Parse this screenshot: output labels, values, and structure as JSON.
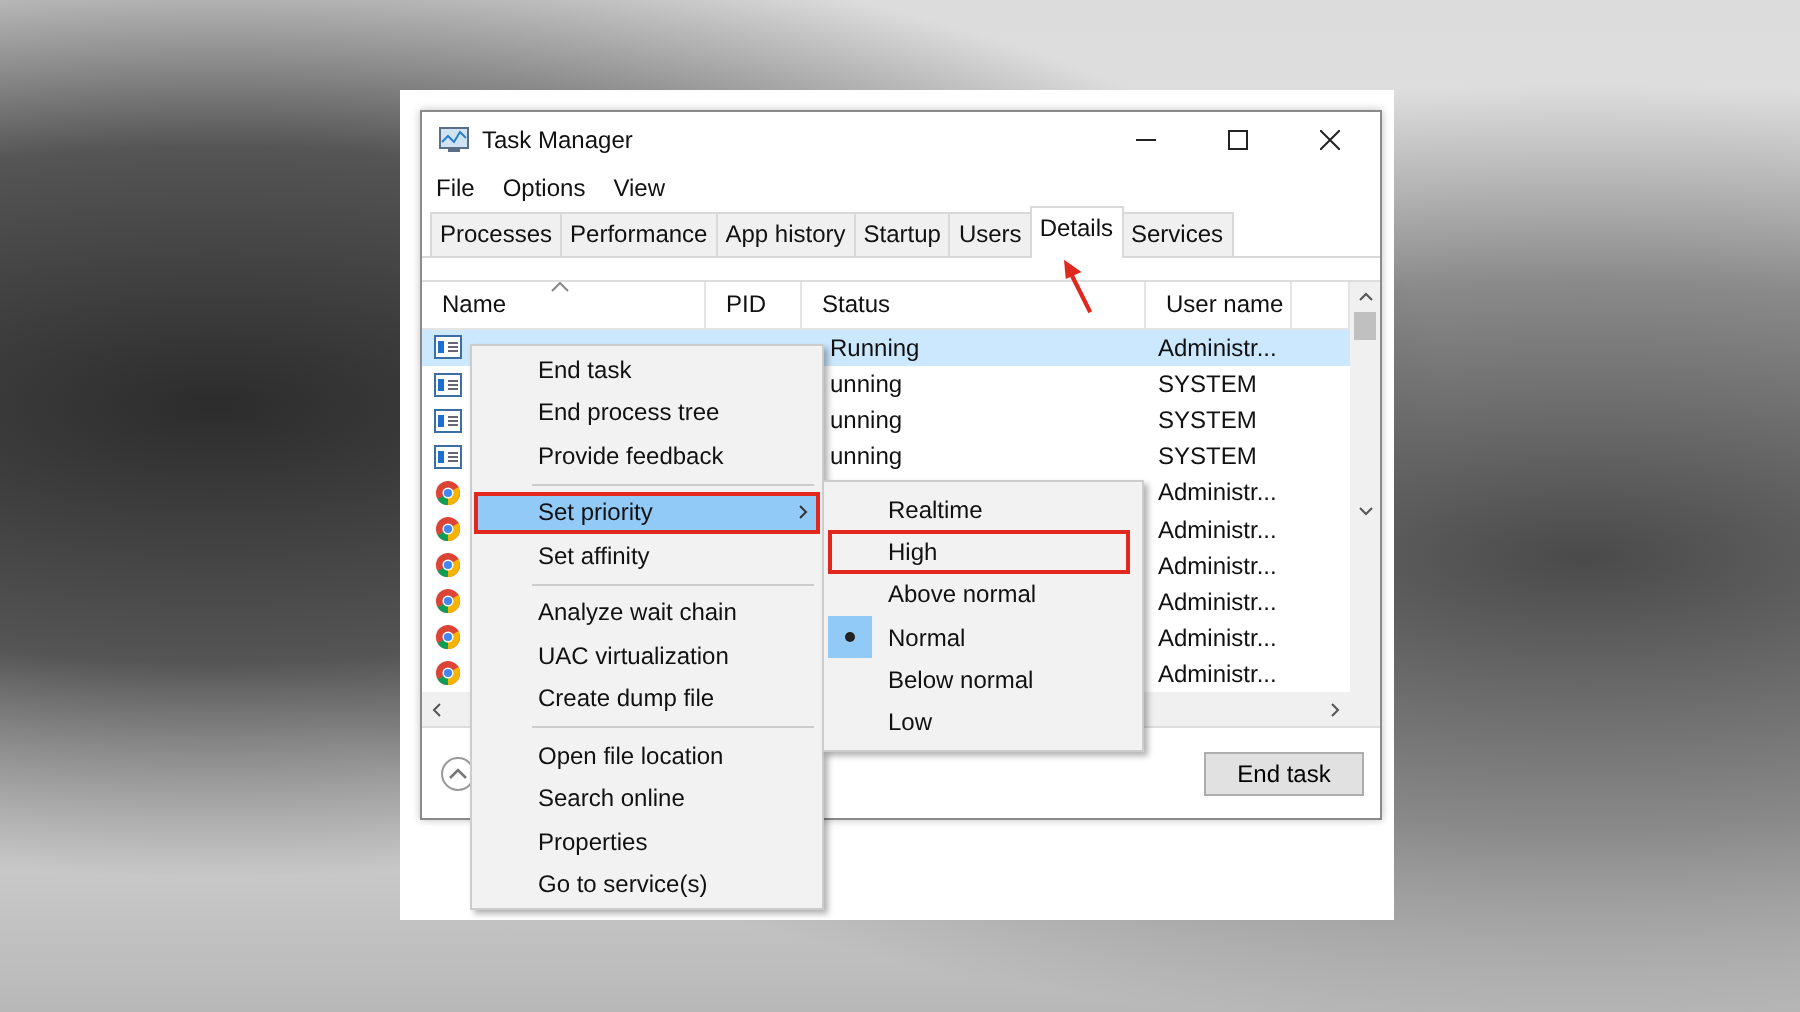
{
  "window": {
    "title": "Task Manager"
  },
  "menu_bar": [
    "File",
    "Options",
    "View"
  ],
  "tabs": [
    {
      "label": "Processes",
      "selected": false
    },
    {
      "label": "Performance",
      "selected": false
    },
    {
      "label": "App history",
      "selected": false
    },
    {
      "label": "Startup",
      "selected": false
    },
    {
      "label": "Users",
      "selected": false
    },
    {
      "label": "Details",
      "selected": true
    },
    {
      "label": "Services",
      "selected": false
    }
  ],
  "table": {
    "columns": [
      {
        "label": "Name",
        "sorted": true
      },
      {
        "label": "PID",
        "sorted": false
      },
      {
        "label": "Status",
        "sorted": false
      },
      {
        "label": "User name",
        "sorted": false
      }
    ],
    "rows": [
      {
        "kind": "app",
        "selected": true,
        "status": "Running",
        "user": "Administr..."
      },
      {
        "kind": "app",
        "selected": false,
        "status": "unning",
        "user": "SYSTEM"
      },
      {
        "kind": "app",
        "selected": false,
        "status": "unning",
        "user": "SYSTEM"
      },
      {
        "kind": "app",
        "selected": false,
        "status": "unning",
        "user": "SYSTEM"
      },
      {
        "kind": "browser",
        "selected": false,
        "user": "Administr..."
      },
      {
        "kind": "browser",
        "selected": false,
        "user": "Administr..."
      },
      {
        "kind": "browser",
        "selected": false,
        "user": "Administr..."
      },
      {
        "kind": "browser",
        "selected": false,
        "user": "Administr..."
      },
      {
        "kind": "browser",
        "selected": false,
        "user": "Administr..."
      },
      {
        "kind": "browser",
        "selected": false,
        "user": "Administr..."
      }
    ]
  },
  "end_task_button": "End task",
  "context_menu": [
    {
      "kind": "item",
      "label": "End task",
      "hovered": false,
      "annotated": false,
      "submenu": false
    },
    {
      "kind": "item",
      "label": "End process tree",
      "hovered": false,
      "annotated": false,
      "submenu": false
    },
    {
      "kind": "item",
      "label": "Provide feedback",
      "hovered": false,
      "annotated": false,
      "submenu": false
    },
    {
      "kind": "separator"
    },
    {
      "kind": "item",
      "label": "Set priority",
      "hovered": true,
      "annotated": true,
      "submenu": true
    },
    {
      "kind": "item",
      "label": "Set affinity",
      "hovered": false,
      "annotated": false,
      "submenu": false
    },
    {
      "kind": "separator"
    },
    {
      "kind": "item",
      "label": "Analyze wait chain",
      "hovered": false,
      "annotated": false,
      "submenu": false
    },
    {
      "kind": "item",
      "label": "UAC virtualization",
      "hovered": false,
      "annotated": false,
      "submenu": false
    },
    {
      "kind": "item",
      "label": "Create dump file",
      "hovered": false,
      "annotated": false,
      "submenu": false
    },
    {
      "kind": "separator"
    },
    {
      "kind": "item",
      "label": "Open file location",
      "hovered": false,
      "annotated": false,
      "submenu": false
    },
    {
      "kind": "item",
      "label": "Search online",
      "hovered": false,
      "annotated": false,
      "submenu": false
    },
    {
      "kind": "item",
      "label": "Properties",
      "hovered": false,
      "annotated": false,
      "submenu": false
    },
    {
      "kind": "item",
      "label": "Go to service(s)",
      "hovered": false,
      "annotated": false,
      "submenu": false
    }
  ],
  "priority_submenu": [
    {
      "label": "Realtime",
      "selected": false,
      "annotated": false
    },
    {
      "label": "High",
      "selected": false,
      "annotated": true
    },
    {
      "label": "Above normal",
      "selected": false,
      "annotated": false
    },
    {
      "label": "Normal",
      "selected": true,
      "annotated": false
    },
    {
      "label": "Below normal",
      "selected": false,
      "annotated": false
    },
    {
      "label": "Low",
      "selected": false,
      "annotated": false
    }
  ]
}
